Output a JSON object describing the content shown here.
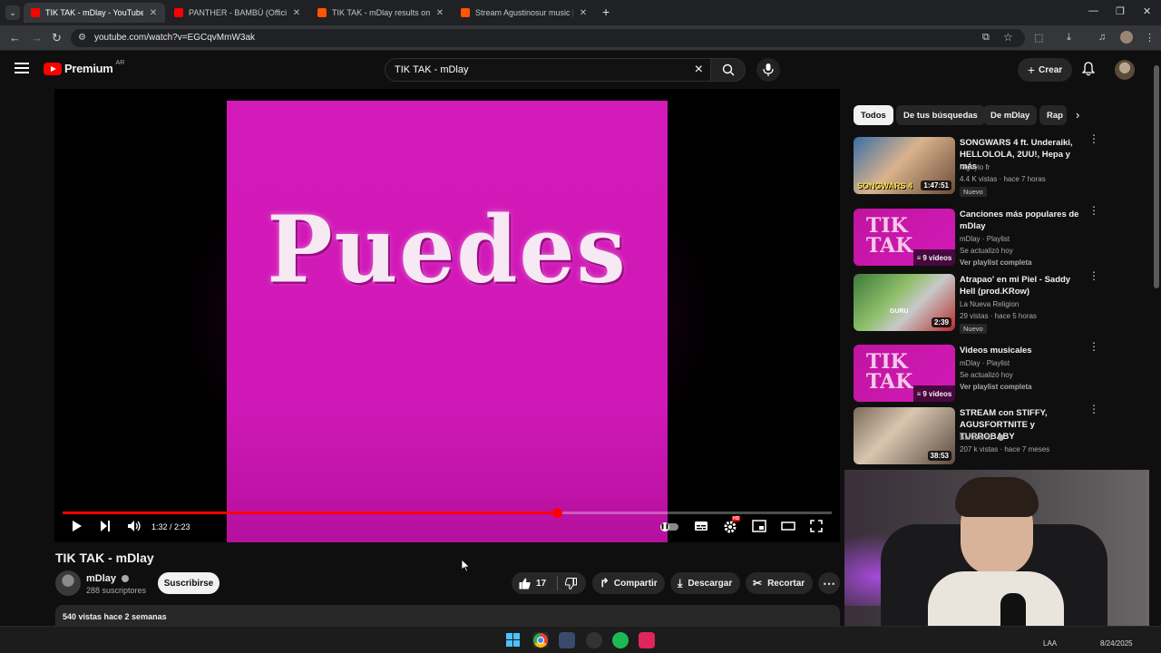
{
  "browser": {
    "tabs": [
      {
        "title": "TIK TAK - mDlay - YouTube",
        "favicon_color": "#ff0000",
        "active": true
      },
      {
        "title": "PANTHER - BAMBÚ (Official Vi",
        "favicon_color": "#ff0000",
        "active": false
      },
      {
        "title": "TIK TAK - mDlay results on Sou",
        "favicon_color": "#ff5500",
        "active": false
      },
      {
        "title": "Stream Agustinosur music | List",
        "favicon_color": "#ff5500",
        "active": false
      }
    ],
    "url": "youtube.com/watch?v=EGCqvMmW3ak"
  },
  "header": {
    "logo_text": "Premium",
    "country_code": "AR",
    "search_value": "TIK TAK - mDlay",
    "create_label": "Crear"
  },
  "player": {
    "cover_text": "Puedes",
    "current_time": "1:32",
    "duration": "2:23",
    "timecode": "1:32 / 2:23",
    "progress_fraction": 0.643,
    "hd_badge": "HD"
  },
  "video": {
    "title": "TIK TAK - mDlay",
    "channel_name": "mDlay",
    "subscribers": "288 suscriptores",
    "subscribe_label": "Suscribirse",
    "likes": "17",
    "share_label": "Compartir",
    "download_label": "Descargar",
    "clip_label": "Recortar",
    "views_date": "540 vistas  hace 2 semanas"
  },
  "sidebar": {
    "chips": [
      "Todos",
      "De tus búsquedas",
      "De mDlay",
      "Rap"
    ],
    "recommendations": [
      {
        "title": "SONGWARS 4 ft. Underaiki, HELLOLOLA, 2UU!, Hepa y más",
        "channel": "rageylo fr",
        "meta": "4.4 K vistas · hace 7 horas",
        "duration": "1:47:51",
        "badge": "Nuevo",
        "thumb_text": "SONGWARS 4"
      },
      {
        "title": "Canciones más populares de mDlay",
        "channel": "mDlay · Playlist",
        "meta": "Se actualizó hoy",
        "link": "Ver playlist completa",
        "count": "9 videos",
        "thumb_text": "TIK TAK"
      },
      {
        "title": "Atrapao' en mi Piel - Saddy Hell (prod.KRow)",
        "channel": "La Nueva Religion",
        "meta": "29 vistas · hace 5 horas",
        "duration": "2:39",
        "badge": "Nuevo",
        "thumb_text": "GURU"
      },
      {
        "title": "Videos musicales",
        "channel": "mDlay · Playlist",
        "meta": "Se actualizó hoy",
        "link": "Ver playlist completa",
        "count": "9 videos",
        "thumb_text": "TIK TAK"
      },
      {
        "title": "STREAM con STIFFY, AGUSFORTNITE y TURROBABY",
        "channel": "Bananirou",
        "meta": "207 k vistas · hace 7 meses",
        "duration": "38:53"
      }
    ]
  },
  "taskbar": {
    "lang": "LAA",
    "date": "8/24/2025"
  },
  "colors": {
    "accent_red": "#ff0000",
    "cover_pink": "#d31ab8",
    "background": "#0f0f0f"
  }
}
